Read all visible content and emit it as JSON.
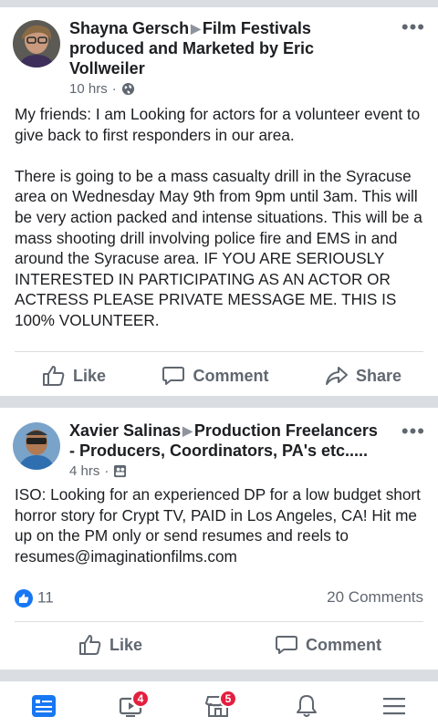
{
  "posts": [
    {
      "author": "Shayna Gersch",
      "group": "Film Festivals produced and Marketed by Eric Vollweiler",
      "time": "10 hrs",
      "privacy_icon": "globe-icon",
      "text": "My friends:  I am Looking for actors for a volunteer event to give back to first responders in our area.\n\nThere is going to be a mass casualty drill in the Syracuse area on Wednesday May 9th from 9pm until 3am. This will be very action packed and intense situations. This will be a mass shooting drill involving police fire and EMS in and around the Syracuse area. IF YOU ARE SERIOUSLY INTERESTED IN PARTICIPATING AS AN ACTOR OR ACTRESS  PLEASE PRIVATE MESSAGE ME.  THIS IS 100% VOLUNTEER.",
      "actions": {
        "like": "Like",
        "comment": "Comment",
        "share": "Share"
      }
    },
    {
      "author": "Xavier Salinas",
      "group": "Production Freelancers - Producers, Coordinators, PA's  etc.....",
      "time": "4 hrs",
      "privacy_icon": "group-icon",
      "text": "ISO: Looking for an experienced DP for a low budget short horror story for Crypt TV, PAID in Los Angeles, CA! Hit me up on the PM only or send resumes and reels to resumes@imaginationfilms.com",
      "reaction_count": "11",
      "comment_count": "20 Comments",
      "actions": {
        "like": "Like",
        "comment": "Comment"
      }
    }
  ],
  "nav": {
    "items": [
      {
        "icon": "news-feed-icon",
        "active": true
      },
      {
        "icon": "watch-icon",
        "badge": "4"
      },
      {
        "icon": "marketplace-icon",
        "badge": "5"
      },
      {
        "icon": "notifications-icon"
      },
      {
        "icon": "menu-icon"
      }
    ]
  },
  "colors": {
    "accent": "#1877f2",
    "badge": "#e41e3f",
    "muted": "#606770"
  }
}
